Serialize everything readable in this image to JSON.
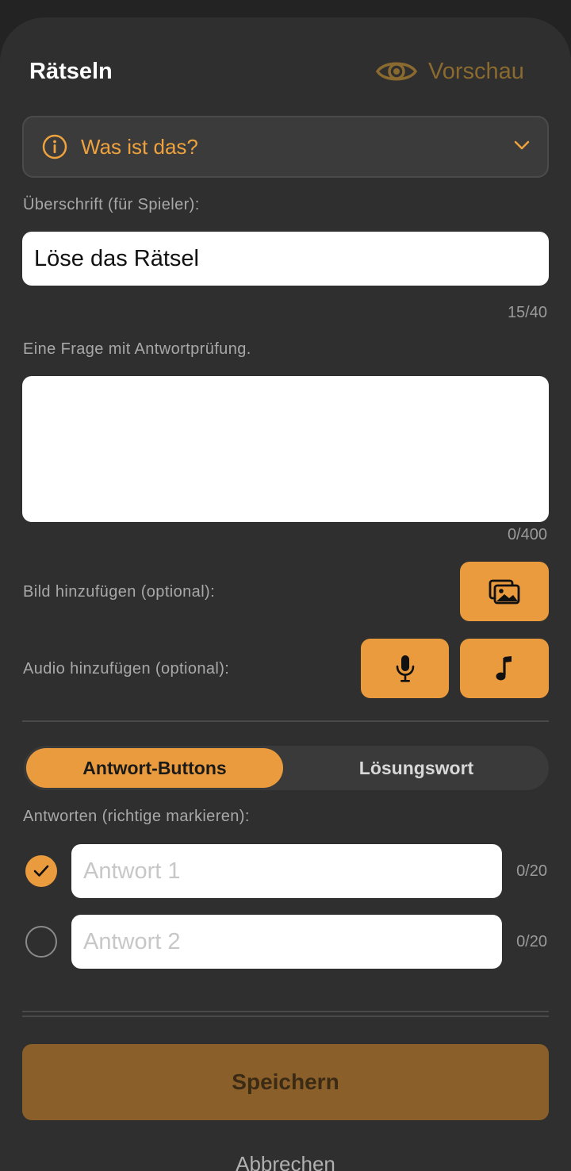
{
  "header": {
    "title": "Rätseln",
    "preview_label": "Vorschau"
  },
  "type_select": {
    "value": "Was ist das?"
  },
  "heading_field": {
    "label": "Überschrift (für Spieler):",
    "value": "Löse das Rätsel",
    "counter": "15/40"
  },
  "question_field": {
    "label": "Eine Frage mit Antwortprüfung.",
    "value": "",
    "counter": "0/400"
  },
  "media": {
    "image_label": "Bild hinzufügen (optional):",
    "audio_label": "Audio hinzufügen (optional):"
  },
  "mode_tabs": {
    "active": "Antwort-Buttons",
    "inactive": "Lösungswort"
  },
  "answers": {
    "label": "Antworten (richtige markieren):",
    "items": [
      {
        "placeholder": "Antwort 1",
        "counter": "0/20",
        "correct": true
      },
      {
        "placeholder": "Antwort 2",
        "counter": "0/20",
        "correct": false
      }
    ]
  },
  "footer": {
    "save_label": "Speichern",
    "cancel_label": "Abbrechen"
  },
  "colors": {
    "accent": "#ea9b3d",
    "accent_muted": "#8a5f2a",
    "background": "#2f2f2f"
  },
  "icons": {
    "preview": "eye-icon",
    "info": "info-icon",
    "dropdown": "chevron-down-icon",
    "image": "image-gallery-icon",
    "record": "microphone-icon",
    "audio_file": "music-note-icon",
    "checked": "checkmark-icon"
  }
}
